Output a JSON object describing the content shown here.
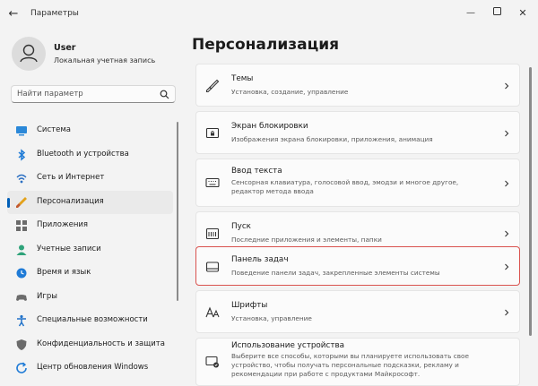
{
  "window": {
    "title": "Параметры"
  },
  "user": {
    "name": "User",
    "account_type": "Локальная учетная запись"
  },
  "search": {
    "placeholder": "Найти параметр"
  },
  "sidebar": {
    "items": [
      {
        "label": "Система",
        "icon": "monitor-icon"
      },
      {
        "label": "Bluetooth и устройства",
        "icon": "bluetooth-icon"
      },
      {
        "label": "Сеть и Интернет",
        "icon": "wifi-icon"
      },
      {
        "label": "Персонализация",
        "icon": "brush-icon",
        "active": true
      },
      {
        "label": "Приложения",
        "icon": "apps-icon"
      },
      {
        "label": "Учетные записи",
        "icon": "person-icon"
      },
      {
        "label": "Время и язык",
        "icon": "globe-clock-icon"
      },
      {
        "label": "Игры",
        "icon": "gamepad-icon"
      },
      {
        "label": "Специальные возможности",
        "icon": "accessibility-icon"
      },
      {
        "label": "Конфиденциальность и защита",
        "icon": "shield-icon"
      },
      {
        "label": "Центр обновления Windows",
        "icon": "update-icon"
      }
    ]
  },
  "main": {
    "title": "Персонализация",
    "cards": [
      {
        "title": "Темы",
        "desc": "Установка, создание, управление",
        "icon": "brush-icon"
      },
      {
        "title": "Экран блокировки",
        "desc": "Изображения экрана блокировки, приложения, анимация",
        "icon": "lock-screen-icon"
      },
      {
        "title": "Ввод текста",
        "desc": "Сенсорная клавиатура, голосовой ввод, эмодзи и многое другое, редактор метода ввода",
        "icon": "keyboard-icon"
      },
      {
        "title": "Пуск",
        "desc": "Последние приложения и элементы, папки",
        "icon": "start-icon"
      },
      {
        "title": "Панель задач",
        "desc": "Поведение панели задач, закрепленные элементы системы",
        "icon": "taskbar-icon",
        "highlighted": true
      },
      {
        "title": "Шрифты",
        "desc": "Установка, управление",
        "icon": "fonts-icon"
      },
      {
        "title": "Использование устройства",
        "desc": "Выберите все способы, которыми вы планируете использовать свое устройство, чтобы получать персональные подсказки, рекламу и рекомендации при работе с продуктами Майкрософт.",
        "icon": "device-usage-icon"
      }
    ]
  },
  "colors": {
    "accent": "#005fb8",
    "highlight": "#d9534f",
    "background": "#f3f3f3",
    "card": "#fbfbfb"
  }
}
